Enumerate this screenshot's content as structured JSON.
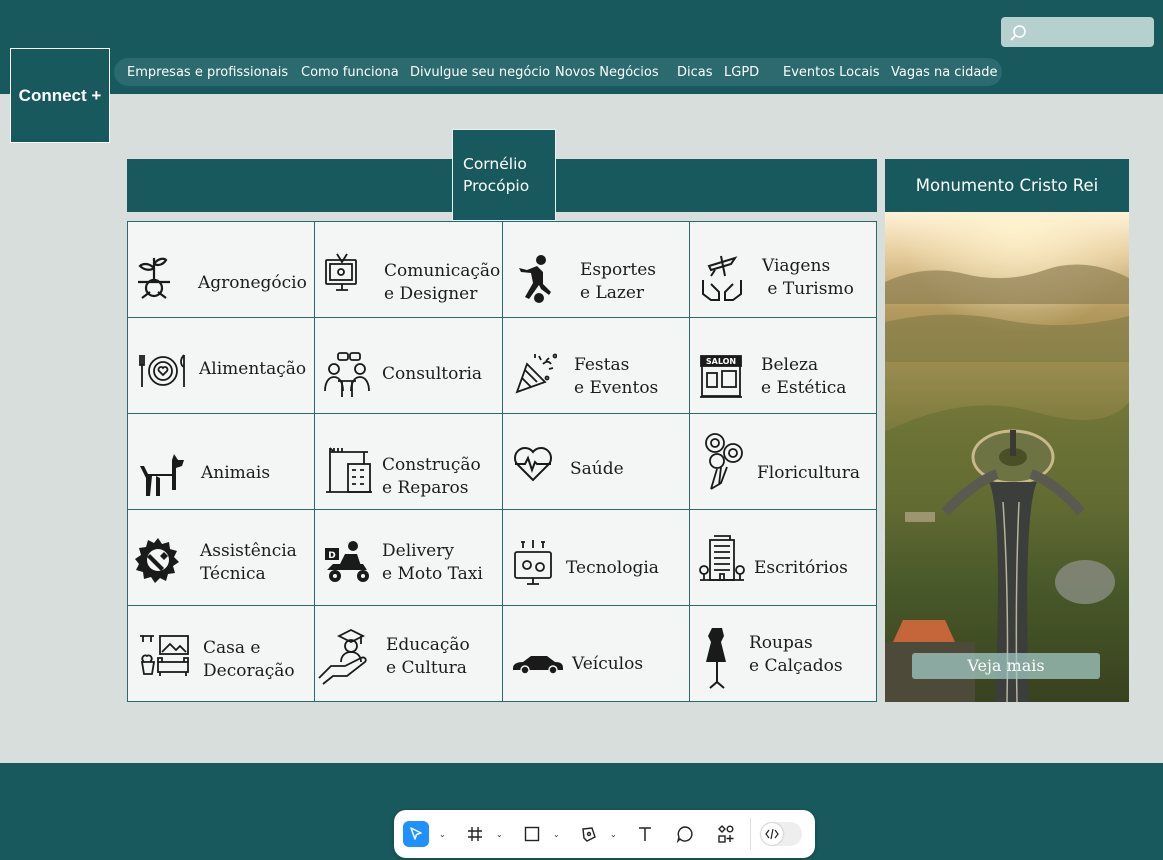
{
  "logo": {
    "text": "Connect +"
  },
  "search": {
    "placeholder": ""
  },
  "nav": {
    "items": [
      {
        "label": "Empresas e profissionais"
      },
      {
        "label": "Como funciona"
      },
      {
        "label": "Divulgue seu negócio"
      },
      {
        "label": "Novos Negócios"
      },
      {
        "label": "Dicas"
      },
      {
        "label": "LGPD"
      },
      {
        "label": "Eventos Locais"
      },
      {
        "label": "Vagas na cidade"
      }
    ]
  },
  "city": {
    "name": "Cornélio\nProcópio"
  },
  "categories": [
    {
      "label": "Agronegócio",
      "icon": "plant-icon"
    },
    {
      "label": "Comunicação\ne Designer",
      "icon": "computer-design-icon"
    },
    {
      "label": "Esportes\ne Lazer",
      "icon": "soccer-player-icon"
    },
    {
      "label": "Viagens\n e Turismo",
      "icon": "airplane-hands-icon"
    },
    {
      "label": "Alimentação",
      "icon": "plate-cutlery-icon"
    },
    {
      "label": "Consultoria",
      "icon": "meeting-icon"
    },
    {
      "label": "Festas\ne Eventos",
      "icon": "party-popper-icon"
    },
    {
      "label": "Beleza\ne Estética",
      "icon": "salon-icon"
    },
    {
      "label": "Animais",
      "icon": "dog-icon"
    },
    {
      "label": "Construção\ne Reparos",
      "icon": "crane-building-icon"
    },
    {
      "label": "Saúde",
      "icon": "heartbeat-icon"
    },
    {
      "label": "Floricultura",
      "icon": "flower-bouquet-icon"
    },
    {
      "label": "Assistência\nTécnica",
      "icon": "gear-wrench-icon"
    },
    {
      "label": "Delivery\ne Moto Taxi",
      "icon": "delivery-scooter-icon"
    },
    {
      "label": "Tecnologia",
      "icon": "tech-monitor-icon"
    },
    {
      "label": "Escritórios",
      "icon": "office-building-icon"
    },
    {
      "label": "Casa e\nDecoração",
      "icon": "home-decor-icon"
    },
    {
      "label": "Educação\ne Cultura",
      "icon": "graduation-hand-icon"
    },
    {
      "label": "Veículos",
      "icon": "car-icon"
    },
    {
      "label": "Roupas\ne Calçados",
      "icon": "dress-form-icon"
    }
  ],
  "sidebar": {
    "title": "Monumento Cristo Rei",
    "cta": "Veja mais"
  },
  "toolbar": {
    "tools": [
      "select-tool",
      "frame-tool",
      "shape-tool",
      "pen-tool",
      "text-tool",
      "comment-tool",
      "components-tool",
      "code-toggle"
    ],
    "active": "select-tool",
    "accent": "#1e90ff"
  },
  "colors": {
    "brand": "#18595e",
    "nav": "#2b6b70",
    "background": "#d8dedc",
    "grid": "#f4f5f5"
  }
}
